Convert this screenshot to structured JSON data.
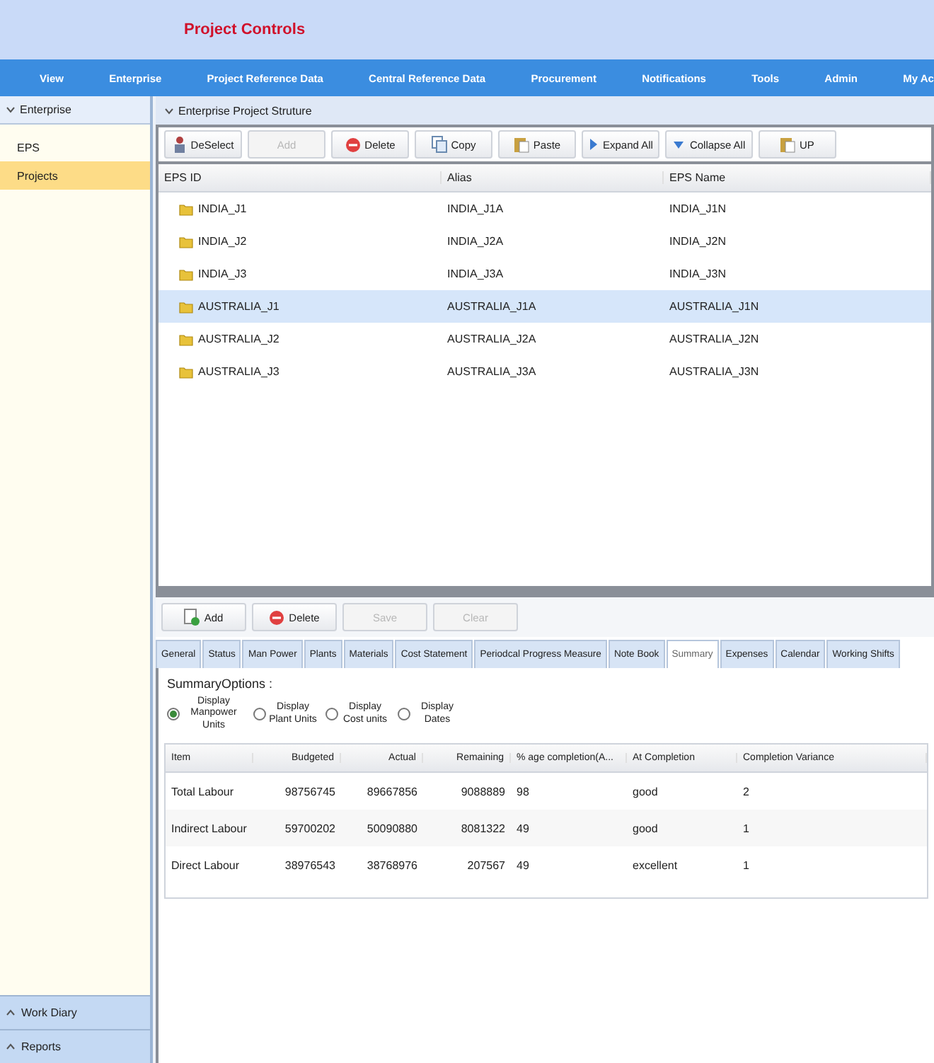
{
  "header": {
    "title": "Project Controls"
  },
  "menu": [
    "View",
    "Enterprise",
    "Project Reference Data",
    "Central Reference Data",
    "Procurement",
    "Notifications",
    "Tools",
    "Admin",
    "My Ac"
  ],
  "sidebar": {
    "section": "Enterprise",
    "expanded": true,
    "items": [
      {
        "label": "EPS",
        "selected": false
      },
      {
        "label": "Projects",
        "selected": true
      }
    ],
    "footer": [
      {
        "label": "Work Diary",
        "expanded": false
      },
      {
        "label": "Reports",
        "expanded": false
      }
    ]
  },
  "panel": {
    "title": "Enterprise Project Struture",
    "expanded": true
  },
  "toolbar": [
    {
      "label": "DeSelect",
      "disabled": false
    },
    {
      "label": "Add",
      "disabled": true
    },
    {
      "label": "Delete",
      "disabled": false
    },
    {
      "label": "Copy",
      "disabled": false
    },
    {
      "label": "Paste",
      "disabled": false
    },
    {
      "label": "Expand All",
      "disabled": false
    },
    {
      "label": "Collapse All",
      "disabled": false
    },
    {
      "label": "UP",
      "disabled": false
    }
  ],
  "eps_table": {
    "columns": [
      "EPS ID",
      "Alias",
      "EPS Name"
    ],
    "rows": [
      {
        "cells": [
          "INDIA_J1",
          "INDIA_J1A",
          "INDIA_J1N"
        ],
        "selected": false
      },
      {
        "cells": [
          "INDIA_J2",
          "INDIA_J2A",
          "INDIA_J2N"
        ],
        "selected": false
      },
      {
        "cells": [
          "INDIA_J3",
          "INDIA_J3A",
          "INDIA_J3N"
        ],
        "selected": false
      },
      {
        "cells": [
          "AUSTRALIA_J1",
          "AUSTRALIA_J1A",
          "AUSTRALIA_J1N"
        ],
        "selected": true
      },
      {
        "cells": [
          "AUSTRALIA_J2",
          "AUSTRALIA_J2A",
          "AUSTRALIA_J2N"
        ],
        "selected": false
      },
      {
        "cells": [
          "AUSTRALIA_J3",
          "AUSTRALIA_J3A",
          "AUSTRALIA_J3N"
        ],
        "selected": false
      }
    ]
  },
  "detail_toolbar": [
    {
      "label": "Add",
      "disabled": false
    },
    {
      "label": "Delete",
      "disabled": false
    },
    {
      "label": "Save",
      "disabled": true
    },
    {
      "label": "Clear",
      "disabled": true
    }
  ],
  "tabs": [
    {
      "label": "General",
      "selected": false
    },
    {
      "label": "Status",
      "selected": false
    },
    {
      "label": "Man Power",
      "selected": false
    },
    {
      "label": "Plants",
      "selected": false
    },
    {
      "label": "Materials",
      "selected": false
    },
    {
      "label": "Cost Statement",
      "selected": false
    },
    {
      "label": "Periodcal Progress Measure",
      "selected": false
    },
    {
      "label": "Note Book",
      "selected": false
    },
    {
      "label": "Summary",
      "selected": true
    },
    {
      "label": "Expenses",
      "selected": false
    },
    {
      "label": "Calendar",
      "selected": false
    },
    {
      "label": "Working Shifts",
      "selected": false
    }
  ],
  "summary_options": {
    "label": "SummaryOptions :",
    "options": [
      {
        "label": "Display Manpower Units",
        "selected": true
      },
      {
        "label": "Display Plant Units",
        "selected": false
      },
      {
        "label": "Display Cost units",
        "selected": false
      },
      {
        "label": "Display Dates",
        "selected": false
      }
    ]
  },
  "summary_table": {
    "columns": [
      "Item",
      "Budgeted",
      "Actual",
      "Remaining",
      "% age completion(A...",
      "At Completion",
      "Completion Variance"
    ],
    "rows": [
      [
        "Total Labour",
        "98756745",
        "89667856",
        "9088889",
        "98",
        "good",
        "2"
      ],
      [
        "Indirect Labour",
        "59700202",
        "50090880",
        "8081322",
        "49",
        "good",
        "1"
      ],
      [
        "Direct Labour",
        "38976543",
        "38768976",
        "207567",
        "49",
        "excellent",
        "1"
      ]
    ]
  }
}
